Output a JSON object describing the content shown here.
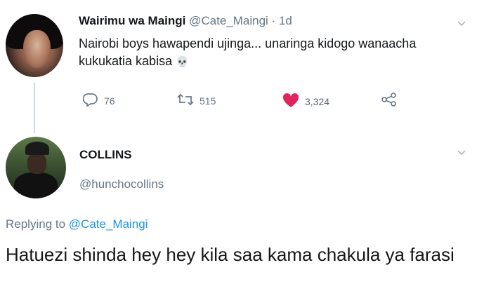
{
  "tweet": {
    "author_name": "Wairimu wa Maingi",
    "author_handle": "@Cate_Maingi",
    "separator": "·",
    "time": "1d",
    "text": "Nairobi boys hawapendi ujinga... unaringa kidogo wanaacha kukukatia kabisa",
    "emoji": "💀",
    "actions": {
      "reply_count": "76",
      "retweet_count": "515",
      "like_count": "3,324"
    },
    "icons": {
      "reply": "reply-icon",
      "retweet": "retweet-icon",
      "like": "heart-icon",
      "share": "share-icon",
      "menu": "chevron-down-icon"
    },
    "colors": {
      "like": "#e0245e",
      "icon_gray": "#657786"
    }
  },
  "reply": {
    "author_name": "COLLINS",
    "author_handle": "@hunchocollins",
    "replying_prefix": "Replying to",
    "replying_to": "@Cate_Maingi",
    "text": "Hatuezi shinda hey hey kila saa kama chakula ya farasi",
    "colors": {
      "mention": "#1b95e0"
    }
  }
}
